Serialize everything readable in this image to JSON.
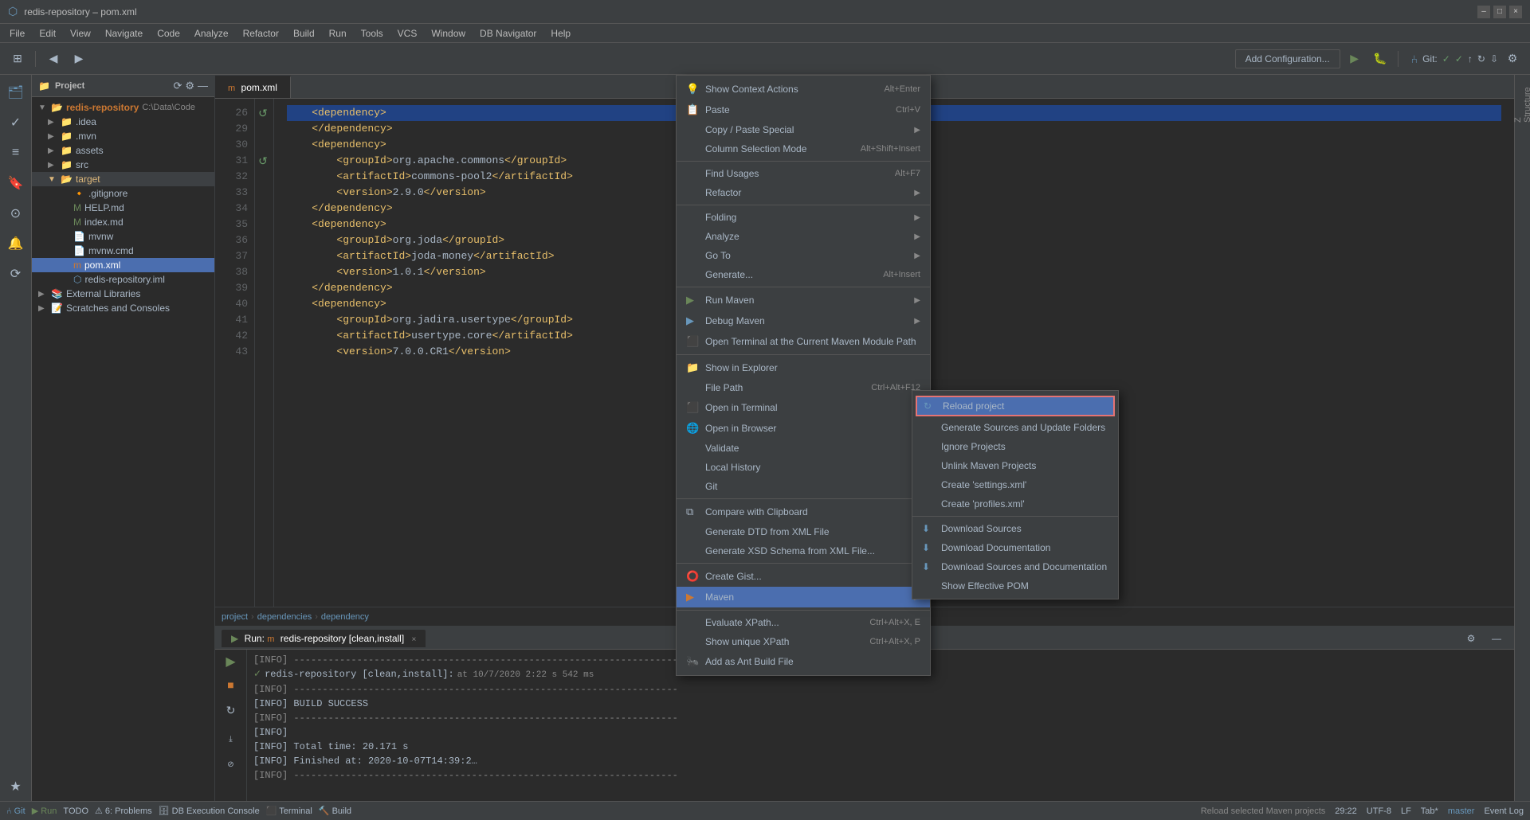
{
  "titleBar": {
    "title": "redis-repository – pom.xml",
    "minimizeLabel": "–",
    "maximizeLabel": "□",
    "closeLabel": "×"
  },
  "menuBar": {
    "items": [
      "File",
      "Edit",
      "View",
      "Navigate",
      "Code",
      "Analyze",
      "Refactor",
      "Build",
      "Run",
      "Tools",
      "VCS",
      "Window",
      "DB Navigator",
      "Help"
    ]
  },
  "toolbar": {
    "addConfigLabel": "Add Configuration...",
    "gitLabel": "Git:"
  },
  "breadcrumb": {
    "project": "project",
    "dependencies": "dependencies",
    "dependency": "dependency"
  },
  "projectPanel": {
    "title": "Project",
    "rootLabel": "redis-repository",
    "rootPath": "C:\\Data\\Code",
    "folders": [
      {
        "name": ".idea",
        "indent": 1,
        "type": "folder",
        "expanded": false
      },
      {
        "name": ".mvn",
        "indent": 1,
        "type": "folder",
        "expanded": false
      },
      {
        "name": "assets",
        "indent": 1,
        "type": "folder",
        "expanded": false
      },
      {
        "name": "src",
        "indent": 1,
        "type": "folder",
        "expanded": false
      },
      {
        "name": "target",
        "indent": 1,
        "type": "folder",
        "expanded": true,
        "highlighted": true
      }
    ],
    "files": [
      {
        "name": ".gitignore",
        "indent": 2,
        "type": "file",
        "icon": "git"
      },
      {
        "name": "HELP.md",
        "indent": 2,
        "type": "file",
        "icon": "md"
      },
      {
        "name": "index.md",
        "indent": 2,
        "type": "file",
        "icon": "md"
      },
      {
        "name": "mvnw",
        "indent": 2,
        "type": "file",
        "icon": "mvn"
      },
      {
        "name": "mvnw.cmd",
        "indent": 2,
        "type": "file",
        "icon": "cmd"
      },
      {
        "name": "pom.xml",
        "indent": 2,
        "type": "file",
        "icon": "maven",
        "selected": true
      },
      {
        "name": "redis-repository.iml",
        "indent": 2,
        "type": "file",
        "icon": "iml"
      }
    ],
    "externalLibraries": "External Libraries",
    "scratchesAndConsoles": "Scratches and Consoles"
  },
  "editor": {
    "tabs": [
      {
        "label": "pom.xml",
        "active": true
      }
    ],
    "lines": [
      {
        "num": "26",
        "content": "    <dependency>",
        "highlight": true
      },
      {
        "num": "",
        "content": ""
      },
      {
        "num": "29",
        "content": "    </dependency>"
      },
      {
        "num": "30",
        "content": "    <dependency>"
      },
      {
        "num": "31",
        "content": "        <groupId>org.apache.commons</groupId>"
      },
      {
        "num": "32",
        "content": "        <artifactId>commons-pool2</artifactId>"
      },
      {
        "num": "33",
        "content": "        <version>2.9.0</version>"
      },
      {
        "num": "34",
        "content": "    </dependency>"
      },
      {
        "num": "35",
        "content": "    <dependency>"
      },
      {
        "num": "36",
        "content": "        <groupId>org.joda</groupId>"
      },
      {
        "num": "37",
        "content": "        <artifactId>joda-money</artifactId>"
      },
      {
        "num": "38",
        "content": "        <version>1.0.1</version>"
      },
      {
        "num": "39",
        "content": "    </dependency>"
      },
      {
        "num": "40",
        "content": "    <dependency>"
      },
      {
        "num": "41",
        "content": "        <groupId>org.jadira.usertype</groupId>"
      },
      {
        "num": "42",
        "content": "        <artifactId>usertype.core</artifactId>"
      },
      {
        "num": "43",
        "content": "        <version>7.0.0.CR1</version>"
      }
    ]
  },
  "bottomPanel": {
    "tabs": [
      {
        "label": "Run:",
        "sublabel": "redis-repository [clean,install]",
        "active": true
      }
    ],
    "lines": [
      {
        "type": "info",
        "text": "[INFO] -----------------------------------------------------------"
      },
      {
        "type": "success",
        "text": "  redis-repository [clean,install]:  at 10/7/2020 2:22 s 542 ms"
      },
      {
        "type": "info",
        "text": "[INFO] -----------------------------------------------------------"
      },
      {
        "type": "normal",
        "text": "[INFO] BUILD SUCCESS"
      },
      {
        "type": "info",
        "text": "[INFO] -----------------------------------------------------------"
      },
      {
        "type": "normal",
        "text": "[INFO]"
      },
      {
        "type": "normal",
        "text": "[INFO] Total time:  20.171 s"
      },
      {
        "type": "normal",
        "text": "[INFO] Finished at: 2020-10-07T14:39:2…"
      },
      {
        "type": "info",
        "text": "[INFO] -----------------------------------------------------------"
      }
    ]
  },
  "statusBar": {
    "git": "⑃ Git",
    "run": "▶ Run",
    "todo": "TODO",
    "problems": "⑥ 6: Problems",
    "dbConsole": "DB Execution Console",
    "terminal": "Terminal",
    "build": "Build",
    "time": "29:22",
    "encoding": "UTF-8",
    "lineSep": "LF",
    "indent": "Tab*",
    "branch": "master",
    "statusMessage": "Reload selected Maven projects"
  },
  "contextMenu": {
    "items": [
      {
        "id": "show-context-actions",
        "icon": "💡",
        "label": "Show Context Actions",
        "shortcut": "Alt+Enter",
        "hasSubmenu": false
      },
      {
        "id": "paste",
        "icon": "📋",
        "label": "Paste",
        "shortcut": "Ctrl+V",
        "hasSubmenu": false
      },
      {
        "id": "copy-paste-special",
        "icon": "",
        "label": "Copy / Paste Special",
        "shortcut": "",
        "hasSubmenu": true
      },
      {
        "id": "column-selection-mode",
        "icon": "",
        "label": "Column Selection Mode",
        "shortcut": "Alt+Shift+Insert",
        "hasSubmenu": false
      },
      {
        "id": "sep1",
        "type": "separator"
      },
      {
        "id": "find-usages",
        "icon": "",
        "label": "Find Usages",
        "shortcut": "Alt+F7",
        "hasSubmenu": false
      },
      {
        "id": "refactor",
        "icon": "",
        "label": "Refactor",
        "shortcut": "",
        "hasSubmenu": true
      },
      {
        "id": "sep2",
        "type": "separator"
      },
      {
        "id": "folding",
        "icon": "",
        "label": "Folding",
        "shortcut": "",
        "hasSubmenu": true
      },
      {
        "id": "analyze",
        "icon": "",
        "label": "Analyze",
        "shortcut": "",
        "hasSubmenu": true
      },
      {
        "id": "goto",
        "icon": "",
        "label": "Go To",
        "shortcut": "",
        "hasSubmenu": true
      },
      {
        "id": "generate",
        "icon": "",
        "label": "Generate...",
        "shortcut": "Alt+Insert",
        "hasSubmenu": false
      },
      {
        "id": "sep3",
        "type": "separator"
      },
      {
        "id": "run-maven",
        "icon": "▶",
        "label": "Run Maven",
        "shortcut": "",
        "hasSubmenu": true
      },
      {
        "id": "debug-maven",
        "icon": "🐛",
        "label": "Debug Maven",
        "shortcut": "",
        "hasSubmenu": true
      },
      {
        "id": "open-terminal-maven",
        "icon": "⬛",
        "label": "Open Terminal at the Current Maven Module Path",
        "shortcut": "",
        "hasSubmenu": false
      },
      {
        "id": "sep4",
        "type": "separator"
      },
      {
        "id": "show-explorer",
        "icon": "📁",
        "label": "Show in Explorer",
        "shortcut": "",
        "hasSubmenu": false
      },
      {
        "id": "file-path",
        "icon": "",
        "label": "File Path",
        "shortcut": "Ctrl+Alt+F12",
        "hasSubmenu": false
      },
      {
        "id": "open-terminal",
        "icon": "⬛",
        "label": "Open in Terminal",
        "shortcut": "",
        "hasSubmenu": false
      },
      {
        "id": "open-browser",
        "icon": "🌐",
        "label": "Open in Browser",
        "shortcut": "",
        "hasSubmenu": false
      },
      {
        "id": "validate",
        "icon": "",
        "label": "Validate",
        "shortcut": "",
        "hasSubmenu": false
      },
      {
        "id": "local-history",
        "icon": "",
        "label": "Local History",
        "shortcut": "",
        "hasSubmenu": true
      },
      {
        "id": "git",
        "icon": "",
        "label": "Git",
        "shortcut": "",
        "hasSubmenu": true
      },
      {
        "id": "sep5",
        "type": "separator"
      },
      {
        "id": "compare-clipboard",
        "icon": "⧉",
        "label": "Compare with Clipboard",
        "shortcut": "",
        "hasSubmenu": false
      },
      {
        "id": "generate-dtd",
        "icon": "",
        "label": "Generate DTD from XML File",
        "shortcut": "",
        "hasSubmenu": false
      },
      {
        "id": "generate-xsd",
        "icon": "",
        "label": "Generate XSD Schema from XML File...",
        "shortcut": "",
        "hasSubmenu": false
      },
      {
        "id": "sep6",
        "type": "separator"
      },
      {
        "id": "create-gist",
        "icon": "🐙",
        "label": "Create Gist...",
        "shortcut": "",
        "hasSubmenu": false
      },
      {
        "id": "maven",
        "icon": "▶",
        "label": "Maven",
        "shortcut": "",
        "hasSubmenu": true,
        "highlighted": true
      },
      {
        "id": "sep7",
        "type": "separator"
      },
      {
        "id": "evaluate-xpath",
        "icon": "",
        "label": "Evaluate XPath...",
        "shortcut": "Ctrl+Alt+X, E",
        "hasSubmenu": false
      },
      {
        "id": "show-unique-xpath",
        "icon": "",
        "label": "Show unique XPath",
        "shortcut": "Ctrl+Alt+X, P",
        "hasSubmenu": false
      },
      {
        "id": "add-ant-build",
        "icon": "🐜",
        "label": "Add as Ant Build File",
        "shortcut": "",
        "hasSubmenu": false
      }
    ]
  },
  "mavenSubmenu": {
    "items": [
      {
        "id": "reload-project",
        "icon": "🔄",
        "label": "Reload project",
        "highlighted": true
      },
      {
        "id": "generate-sources",
        "label": "Generate Sources and Update Folders"
      },
      {
        "id": "ignore-projects",
        "label": "Ignore Projects"
      },
      {
        "id": "unlink-maven",
        "label": "Unlink Maven Projects"
      },
      {
        "id": "create-settings",
        "label": "Create 'settings.xml'"
      },
      {
        "id": "create-profiles",
        "label": "Create 'profiles.xml'"
      },
      {
        "id": "sep1",
        "type": "separator"
      },
      {
        "id": "download-sources",
        "icon": "⬇",
        "label": "Download Sources"
      },
      {
        "id": "download-docs",
        "icon": "⬇",
        "label": "Download Documentation"
      },
      {
        "id": "download-sources-docs",
        "icon": "⬇",
        "label": "Download Sources and Documentation"
      },
      {
        "id": "show-effective-pom",
        "label": "Show Effective POM"
      }
    ]
  }
}
